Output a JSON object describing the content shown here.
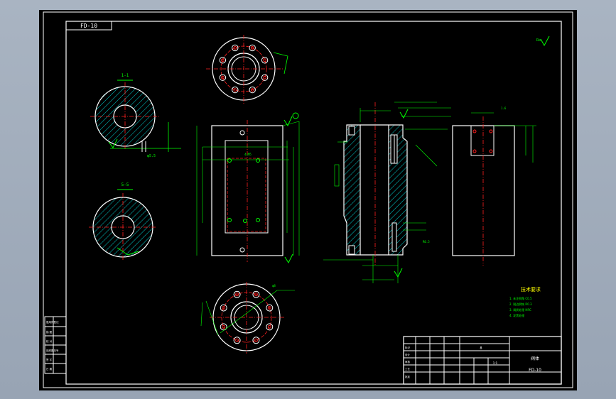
{
  "drawing": {
    "drawing_no": "FD-10",
    "section_a": "1-1",
    "section_b": "5-5",
    "roughness_note": "Ra",
    "tech_requirements": {
      "title": "技术要求",
      "items": [
        "1. 未注倒角 C0.5",
        "2. 锐边倒钝 R0.3",
        "3. 调质处理 HRC",
        "4. 发黑处理"
      ]
    },
    "title_block": {
      "scale": "1:1",
      "name": "阀体",
      "code": "FD-10",
      "sheet": "8",
      "rows": [
        "标记",
        "设计",
        "审核",
        "工艺",
        "批准"
      ]
    },
    "side_strip": [
      "借用件登记",
      "描 图",
      "校 对",
      "旧底图总号",
      "签 字",
      "日 期"
    ],
    "dim_labels": [
      "φ5.5",
      "φ8",
      "4xM5",
      "R0.5",
      "1.6",
      "3.2"
    ]
  }
}
